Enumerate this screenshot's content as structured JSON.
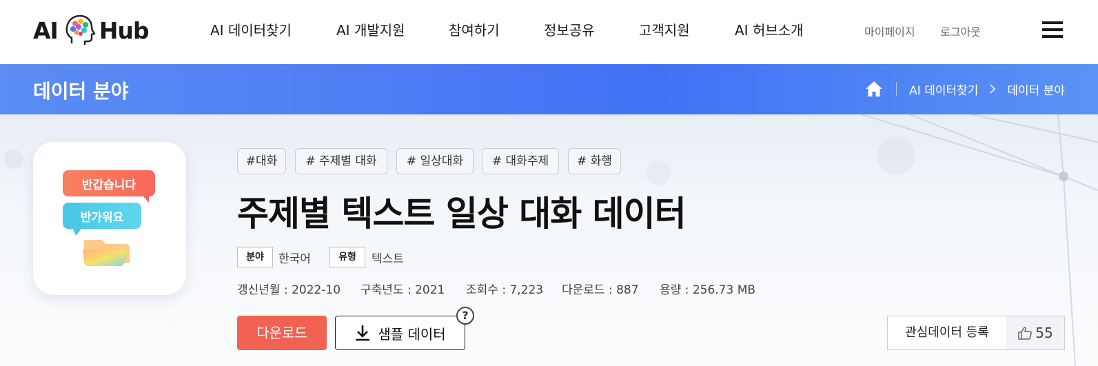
{
  "header": {
    "logo_left": "AI",
    "logo_right": "Hub",
    "nav": [
      "AI 데이터찾기",
      "AI 개발지원",
      "참여하기",
      "정보공유",
      "고객지원",
      "AI 허브소개"
    ],
    "util": [
      "마이페이지",
      "로그아웃"
    ],
    "menu_icon": "hamburger-icon"
  },
  "titlebar": {
    "title": "데이터 분야",
    "breadcrumb": [
      "AI 데이터찾기",
      "데이터 분야"
    ],
    "home_icon": "home-icon"
  },
  "dataset": {
    "thumb_bubbles": [
      "반갑습니다",
      "반가워요"
    ],
    "tags": [
      "#대화",
      "# 주제별 대화",
      "# 일상대화",
      "# 대화주제",
      "# 화행"
    ],
    "title": "주제별 텍스트 일상 대화 데이터",
    "field_label": "분야",
    "field_value": "한국어",
    "type_label": "유형",
    "type_value": "텍스트",
    "updated": "갱신년월 : 2022-10",
    "built": "구축년도 : 2021",
    "views": "조회수 : 7,223",
    "downloads": "다운로드 : 887",
    "size": "용량 : 256.73 MB"
  },
  "actions": {
    "download_label": "다운로드",
    "sample_label": "샘플 데이터",
    "help_label": "?",
    "favorite_label": "관심데이터 등록",
    "like_count": "55"
  },
  "colors": {
    "titlebar": "#4a78f5",
    "download_button": "#f26252"
  }
}
